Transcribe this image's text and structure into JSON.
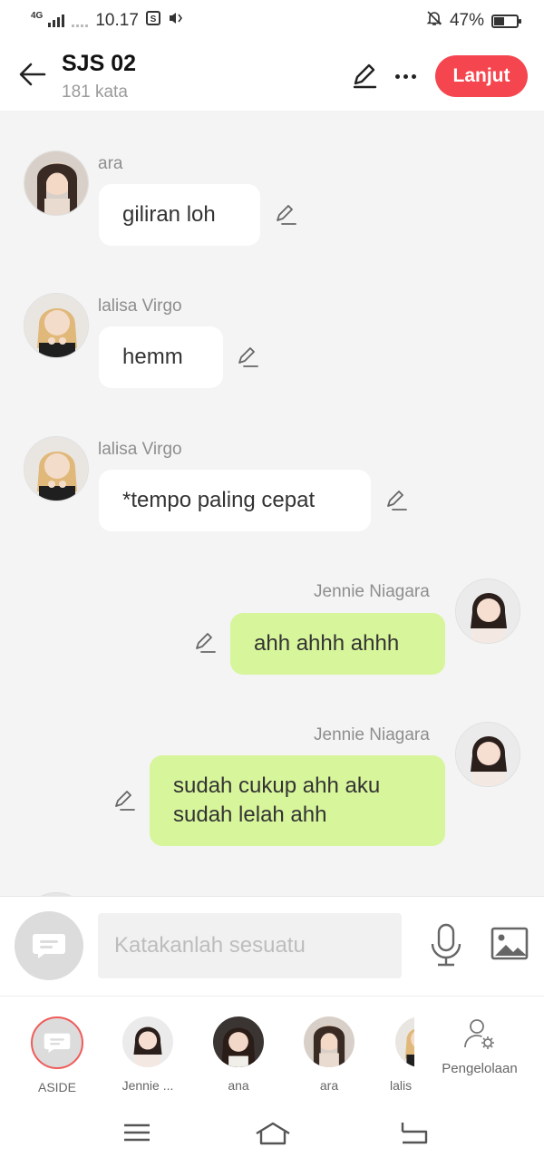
{
  "status_bar": {
    "network": "4G",
    "time": "10.17",
    "battery": "47%",
    "battery_level": 0.47
  },
  "header": {
    "title": "SJS 02",
    "subtitle": "181 kata",
    "next_label": "Lanjut"
  },
  "messages": [
    {
      "sender": "ara",
      "text": "giliran loh",
      "side": "left"
    },
    {
      "sender": "lalisa Virgo",
      "text": "hemm",
      "side": "left"
    },
    {
      "sender": "lalisa Virgo",
      "text": "*tempo paling cepat",
      "side": "left"
    },
    {
      "sender": "Jennie Niagara",
      "text": "ahh ahhh ahhh",
      "side": "right"
    },
    {
      "sender": "Jennie Niagara",
      "text": "sudah cukup ahh aku sudah lelah ahh",
      "side": "right"
    }
  ],
  "composer": {
    "placeholder": "Katakanlah sesuatu"
  },
  "characters": [
    {
      "label": "ASIDE"
    },
    {
      "label": "Jennie ..."
    },
    {
      "label": "ana"
    },
    {
      "label": "ara"
    },
    {
      "label": "lalis"
    }
  ],
  "management_label": "Pengelolaan",
  "colors": {
    "accent": "#f5464f",
    "my_bubble": "#d7f59a",
    "other_bubble": "#ffffff",
    "background": "#f4f4f4"
  }
}
